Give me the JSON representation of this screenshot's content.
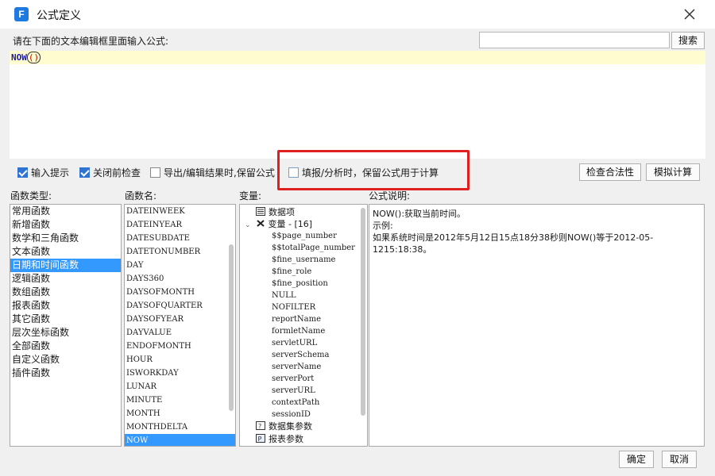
{
  "window": {
    "title": "公式定义",
    "app_icon_letter": "F"
  },
  "prompt_label": "请在下面的文本编辑框里面输入公式:",
  "search": {
    "value": "",
    "placeholder": "",
    "button_label": "搜索"
  },
  "editor": {
    "fn": "NOW",
    "paren": "()"
  },
  "options": {
    "input_hint": {
      "label": "输入提示",
      "checked": true
    },
    "check_before_close": {
      "label": "关闭前检查",
      "checked": true
    },
    "keep_on_export": {
      "label": "导出/编辑结果时,保留公式",
      "checked": false
    },
    "keep_on_fill": {
      "label": "填报/分析时，保留公式用于计算",
      "checked": false
    }
  },
  "buttons": {
    "check_validity": "检查合法性",
    "simulate": "模拟计算",
    "ok": "确定",
    "cancel": "取消"
  },
  "columns": {
    "category": "函数类型:",
    "function": "函数名:",
    "variable": "变量:",
    "description": "公式说明:"
  },
  "categories": [
    "常用函数",
    "新增函数",
    "数学和三角函数",
    "文本函数",
    "日期和时间函数",
    "逻辑函数",
    "数组函数",
    "报表函数",
    "其它函数",
    "层次坐标函数",
    "全部函数",
    "自定义函数",
    "插件函数"
  ],
  "selected_category": "日期和时间函数",
  "functions": [
    "DATEINWEEK",
    "DATEINYEAR",
    "DATESUBDATE",
    "DATETONUMBER",
    "DAY",
    "DAYS360",
    "DAYSOFMONTH",
    "DAYSOFQUARTER",
    "DAYSOFYEAR",
    "DAYVALUE",
    "ENDOFMONTH",
    "HOUR",
    "ISWORKDAY",
    "LUNAR",
    "MINUTE",
    "MONTH",
    "MONTHDELTA",
    "NOW"
  ],
  "selected_function": "NOW",
  "variables": {
    "data_item": "数据项",
    "variable_group": "变量 - [16]",
    "items": [
      "$$page_number",
      "$$totalPage_number",
      "$fine_username",
      "$fine_role",
      "$fine_position",
      "NULL",
      "NOFILTER",
      "reportName",
      "formletName",
      "servletURL",
      "serverSchema",
      "serverName",
      "serverPort",
      "serverURL",
      "contextPath",
      "sessionID"
    ],
    "dataset_params": "数据集参数",
    "report_params": "报表参数"
  },
  "description": {
    "line1": "NOW():获取当前时间。",
    "line2": "示例:",
    "line3": "如果系统时间是2012年5月12日15点18分38秒则NOW()等于2012-05-1215:18:38。"
  },
  "colors": {
    "accent": "#2f74d0",
    "selection": "#3399ff",
    "highlight_border": "#e02020",
    "editor_line_bg": "#fffdd0"
  }
}
